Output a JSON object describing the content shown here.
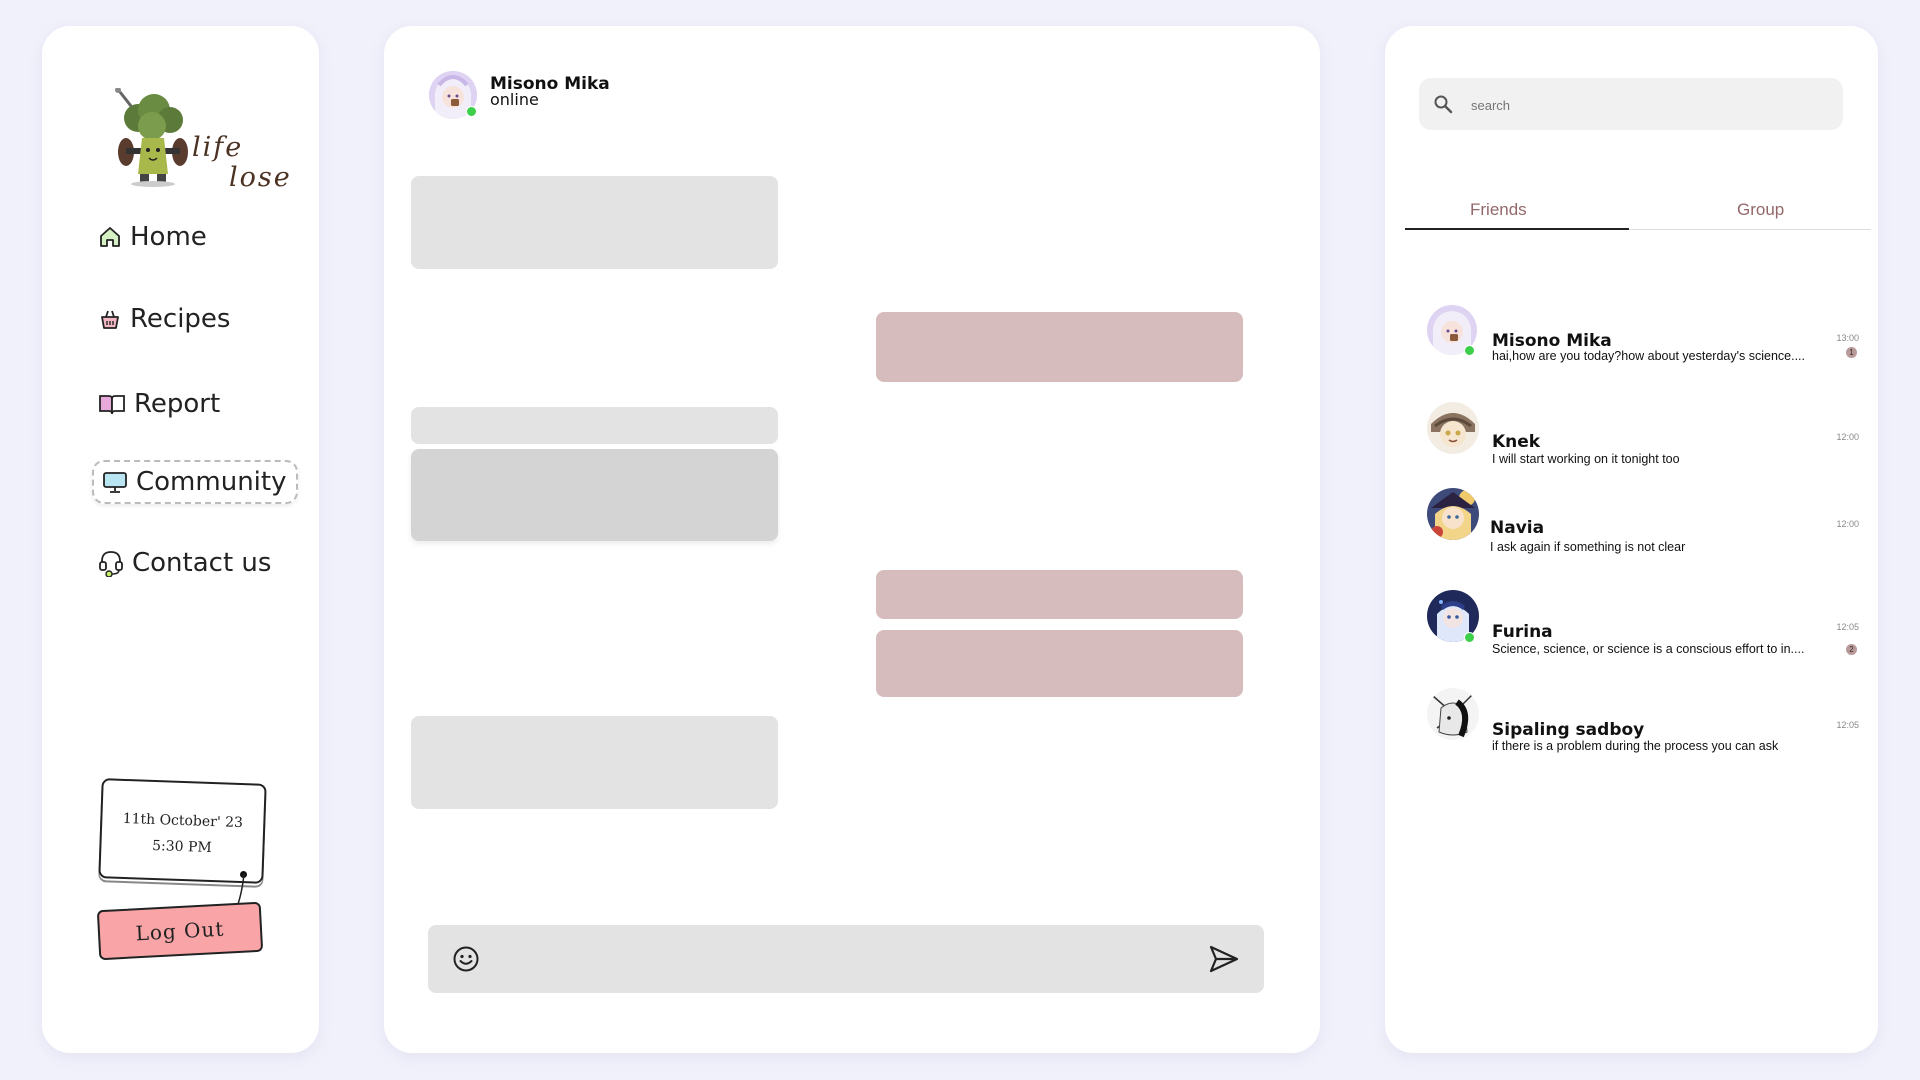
{
  "sidebar": {
    "logo": {
      "word1": "life",
      "word2": "lose"
    },
    "nav": [
      {
        "label": "Home",
        "icon": "home-icon"
      },
      {
        "label": "Recipes",
        "icon": "basket-icon"
      },
      {
        "label": "Report",
        "icon": "book-icon"
      },
      {
        "label": "Community",
        "icon": "monitor-icon",
        "active": true
      },
      {
        "label": "Contact us",
        "icon": "headset-icon"
      }
    ],
    "date": "11th October' 23",
    "time": "5:30 PM",
    "logout_label": "Log Out"
  },
  "chat": {
    "contact_name": "Misono Mika",
    "contact_status": "online",
    "composer": {
      "value": "",
      "placeholder": ""
    }
  },
  "friends_panel": {
    "search_placeholder": "search",
    "tabs": [
      {
        "label": "Friends",
        "active": true
      },
      {
        "label": "Group",
        "active": false
      }
    ],
    "friends": [
      {
        "name": "Misono Mika",
        "message": "hai,how are you today?how about yesterday's science....",
        "time": "13:00",
        "unread": "1",
        "online": true
      },
      {
        "name": "Knek",
        "message": "I will start working on it tonight too",
        "time": "12:00",
        "unread": "",
        "online": false
      },
      {
        "name": "Navia",
        "message": "I ask again if something is not clear",
        "time": "12:00",
        "unread": "",
        "online": false
      },
      {
        "name": "Furina",
        "message": "Science, science, or science is a conscious effort to in....",
        "time": "12:05",
        "unread": "2",
        "online": true
      },
      {
        "name": "Sipaling sadboy",
        "message": "if there is a problem during the process you can ask",
        "time": "12:05",
        "unread": "",
        "online": false
      }
    ]
  },
  "colors": {
    "background": "#f1f1fb",
    "incoming_bubble": "#e3e3e3",
    "outgoing_bubble": "#d6bcbd",
    "tab_text": "#93686a",
    "logout_button": "#f9a5a7",
    "online": "#3bcf4a"
  }
}
